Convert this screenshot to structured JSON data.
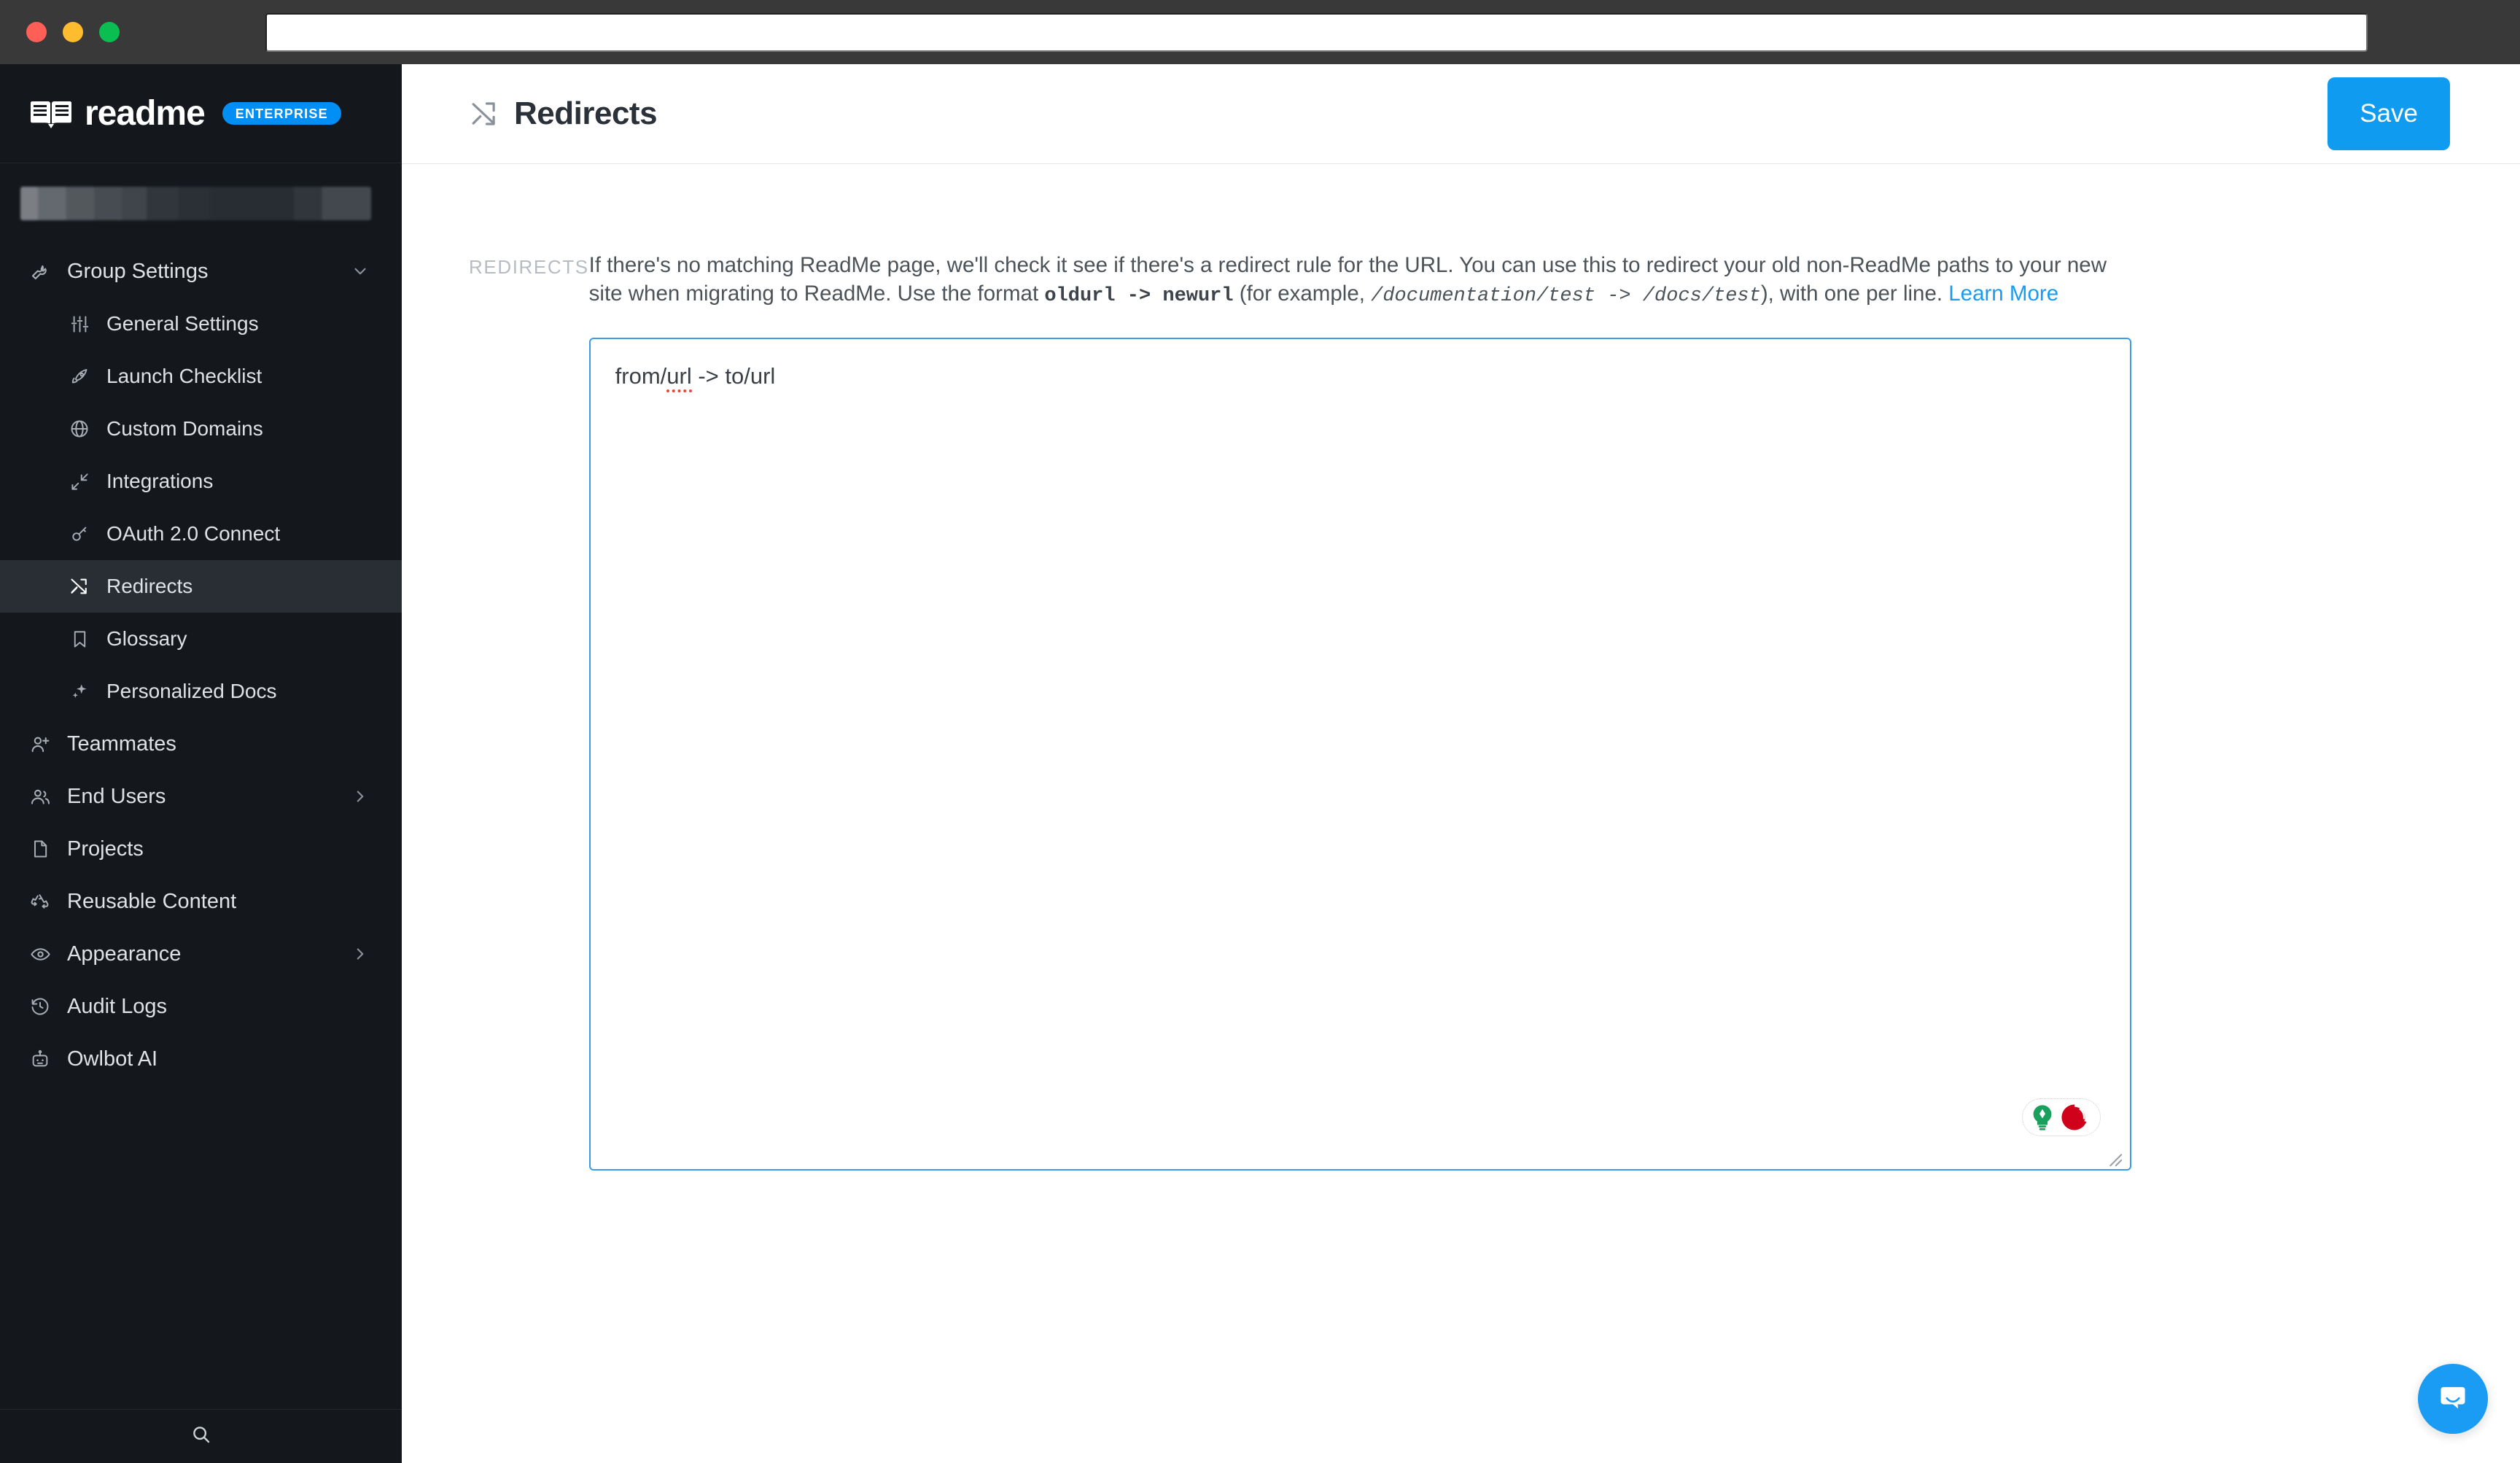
{
  "browser": {
    "traffic_lights": [
      "close",
      "minimize",
      "maximize"
    ],
    "url_value": "",
    "url_placeholder": ""
  },
  "sidebar": {
    "brand": {
      "logo_icon": "readme-book-icon",
      "name": "readme",
      "badge": "ENTERPRISE"
    },
    "redacted_project_name": "",
    "items": [
      {
        "label": "Group Settings",
        "icon": "wrench-icon",
        "level": "top",
        "caret": "chevron-down",
        "active": false
      },
      {
        "label": "General Settings",
        "icon": "sliders-icon",
        "level": "sub",
        "caret": "",
        "active": false
      },
      {
        "label": "Launch Checklist",
        "icon": "rocket-icon",
        "level": "sub",
        "caret": "",
        "active": false
      },
      {
        "label": "Custom Domains",
        "icon": "globe-icon",
        "level": "sub",
        "caret": "",
        "active": false
      },
      {
        "label": "Integrations",
        "icon": "integrations-icon",
        "level": "sub",
        "caret": "",
        "active": false
      },
      {
        "label": "OAuth 2.0 Connect",
        "icon": "key-icon",
        "level": "sub",
        "caret": "",
        "active": false
      },
      {
        "label": "Redirects",
        "icon": "shuffle-icon",
        "level": "sub",
        "caret": "",
        "active": true
      },
      {
        "label": "Glossary",
        "icon": "bookmark-icon",
        "level": "sub",
        "caret": "",
        "active": false
      },
      {
        "label": "Personalized Docs",
        "icon": "sparkles-icon",
        "level": "sub",
        "caret": "",
        "active": false
      },
      {
        "label": "Teammates",
        "icon": "user-plus-icon",
        "level": "top",
        "caret": "",
        "active": false
      },
      {
        "label": "End Users",
        "icon": "users-icon",
        "level": "top",
        "caret": "chevron-right",
        "active": false
      },
      {
        "label": "Projects",
        "icon": "file-icon",
        "level": "top",
        "caret": "",
        "active": false
      },
      {
        "label": "Reusable Content",
        "icon": "recycle-icon",
        "level": "top",
        "caret": "",
        "active": false
      },
      {
        "label": "Appearance",
        "icon": "eye-icon",
        "level": "top",
        "caret": "chevron-right",
        "active": false
      },
      {
        "label": "Audit Logs",
        "icon": "history-icon",
        "level": "top",
        "caret": "",
        "active": false
      },
      {
        "label": "Owlbot AI",
        "icon": "robot-icon",
        "level": "top",
        "caret": "",
        "active": false
      }
    ],
    "footer": {
      "search_icon": "search-icon"
    }
  },
  "header": {
    "icon": "shuffle-icon",
    "title": "Redirects",
    "save_label": "Save"
  },
  "form": {
    "label": "REDIRECTS",
    "help": {
      "part1": "If there's no matching ReadMe page, we'll check it see if there's a redirect rule for the URL. You can use this to redirect your old non-ReadMe paths to your new site when migrating to ReadMe. Use the format ",
      "code1": "oldurl -> newurl",
      "part2": " (for example, ",
      "code2": "/documentation/test -> /docs/test",
      "part3": "), with one per line. ",
      "link": "Learn More"
    },
    "textarea": {
      "value": "from/url -> to/url",
      "placeholder": "",
      "spell_before": "from/",
      "spell_error": "url",
      "spell_after": " -> to/url"
    },
    "grammar_widget": {
      "bulb_icon": "lightbulb-icon",
      "status_icon": "grammarly-dot-icon",
      "bulb_color": "#18a05c",
      "status_color": "#d0021b"
    },
    "resize_handle": "resize-grip-icon"
  },
  "intercom": {
    "icon": "chat-bubble-icon",
    "color": "#1a9bf4"
  }
}
